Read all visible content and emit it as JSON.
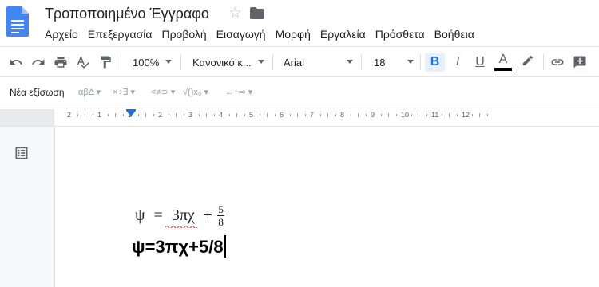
{
  "app": {
    "title": "Τροποποιημένο Έγγραφο",
    "accent_color": "#1a73e8",
    "doc_icon_color": "#4285f4"
  },
  "menu": [
    "Αρχείο",
    "Επεξεργασία",
    "Προβολή",
    "Εισαγωγή",
    "Μορφή",
    "Εργαλεία",
    "Πρόσθετα",
    "Βοήθεια"
  ],
  "toolbar": {
    "zoom": "100%",
    "style": "Κανονικό κ...",
    "font": "Arial",
    "font_size": "18",
    "bold_label": "B",
    "italic_label": "I",
    "underline_label": "U",
    "text_color_label": "A",
    "text_color": "#000000",
    "icons": [
      "undo-icon",
      "redo-icon",
      "print-icon",
      "spellcheck-icon",
      "paint-format-icon",
      "bold-icon",
      "italic-icon",
      "underline-icon",
      "text-color-icon",
      "highlight-icon",
      "link-icon",
      "add-comment-icon"
    ]
  },
  "equation_toolbar": {
    "new_equation": "Νέα εξίσωση",
    "groups": [
      "αβΔ",
      "×÷∃",
      "<≠⊃",
      "√()x₀",
      "←↑⇒"
    ]
  },
  "ruler": {
    "numbers": [
      "2",
      "1",
      "1",
      "2",
      "3",
      "4",
      "5",
      "6",
      "7",
      "8",
      "9",
      "10",
      "11",
      "12"
    ]
  },
  "document": {
    "equation": {
      "lhs": "ψ",
      "eq": "=",
      "term": "3πχ",
      "plus": "+",
      "numerator": "5",
      "denominator": "8"
    },
    "bold_text": "ψ=3πχ+5/8"
  }
}
